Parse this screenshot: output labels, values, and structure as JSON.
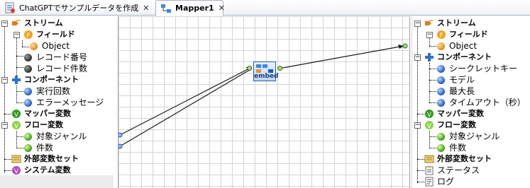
{
  "tabs": [
    {
      "label": "ChatGPTでサンプルデータを作成",
      "close": "✕",
      "active": false
    },
    {
      "label": "Mapper1",
      "close": "✕",
      "active": true
    }
  ],
  "left_tree": {
    "stream": "ストリーム",
    "field": "フィールド",
    "object": "Object",
    "record_no": "レコード番号",
    "record_count": "レコード件数",
    "component": "コンポーネント",
    "exec_count": "実行回数",
    "error_message": "エラーメッセージ",
    "mapper_vars": "マッパー変数",
    "flow_vars": "フロー変数",
    "target_genre": "対象ジャンル",
    "count": "件数",
    "external_vars": "外部変数セット",
    "system_vars": "システム変数"
  },
  "canvas": {
    "embed_label": "embed"
  },
  "right_tree": {
    "stream": "ストリーム",
    "field": "フィールド",
    "object": "Object",
    "component": "コンポーネント",
    "secret_key": "シークレットキー",
    "model": "モデル",
    "max_length": "最大長",
    "timeout": "タイムアウト（秒）",
    "mapper_vars": "マッパー変数",
    "flow_vars": "フロー変数",
    "target_genre": "対象ジャンル",
    "count": "件数",
    "external_vars": "外部変数セット",
    "status": "ステータス",
    "log": "ログ"
  },
  "colors": {
    "stream_icon": "#e07b1a",
    "field_icon": "#f4a21e",
    "component_icon": "#2b6fd6",
    "mapper_var_icon": "#2f9a1a",
    "flow_var_icon": "#8fd24a",
    "system_var_icon": "#b04cc2",
    "connector_line": "#1a1a1a"
  }
}
